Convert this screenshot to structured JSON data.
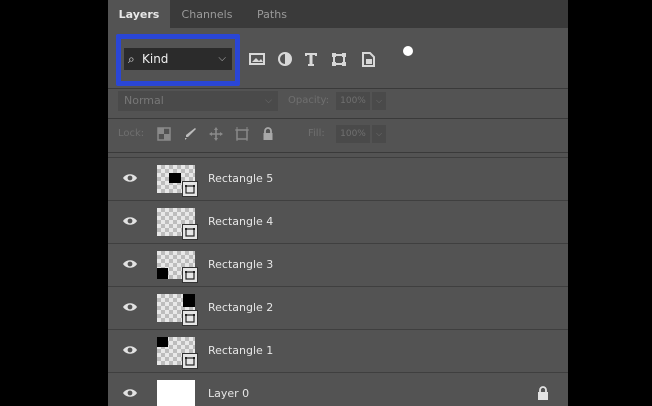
{
  "tabs": [
    "Layers",
    "Channels",
    "Paths"
  ],
  "filter": {
    "kind_label": "Kind",
    "kind_chevron": "⌵",
    "search_glyph": "⌕",
    "icons": [
      "image-filter-icon",
      "adjustment-filter-icon",
      "type-filter-icon",
      "shape-filter-icon",
      "smart-object-filter-icon"
    ]
  },
  "blend": {
    "mode": "Normal",
    "opacity_label": "Opacity:",
    "opacity_value": "100%"
  },
  "lock": {
    "label": "Lock:",
    "fill_label": "Fill:",
    "fill_value": "100%",
    "icons": [
      "lock-transparent-pixels-icon",
      "lock-image-pixels-icon",
      "lock-position-icon",
      "lock-artboard-icon",
      "lock-all-icon"
    ]
  },
  "layers": [
    {
      "name": "Rectangle 5",
      "thumb": "rect5",
      "visible": true
    },
    {
      "name": "Rectangle 4",
      "thumb": "rect4",
      "visible": true
    },
    {
      "name": "Rectangle 3",
      "thumb": "rect3",
      "visible": true
    },
    {
      "name": "Rectangle 2",
      "thumb": "rect2",
      "visible": true
    },
    {
      "name": "Rectangle 1",
      "thumb": "rect1",
      "visible": true
    },
    {
      "name": "Layer 0",
      "thumb": "white",
      "visible": true,
      "locked": true
    }
  ],
  "colors": {
    "highlight": "#2a46d6",
    "panel": "#535353",
    "tabbar": "#3a3a3a"
  }
}
